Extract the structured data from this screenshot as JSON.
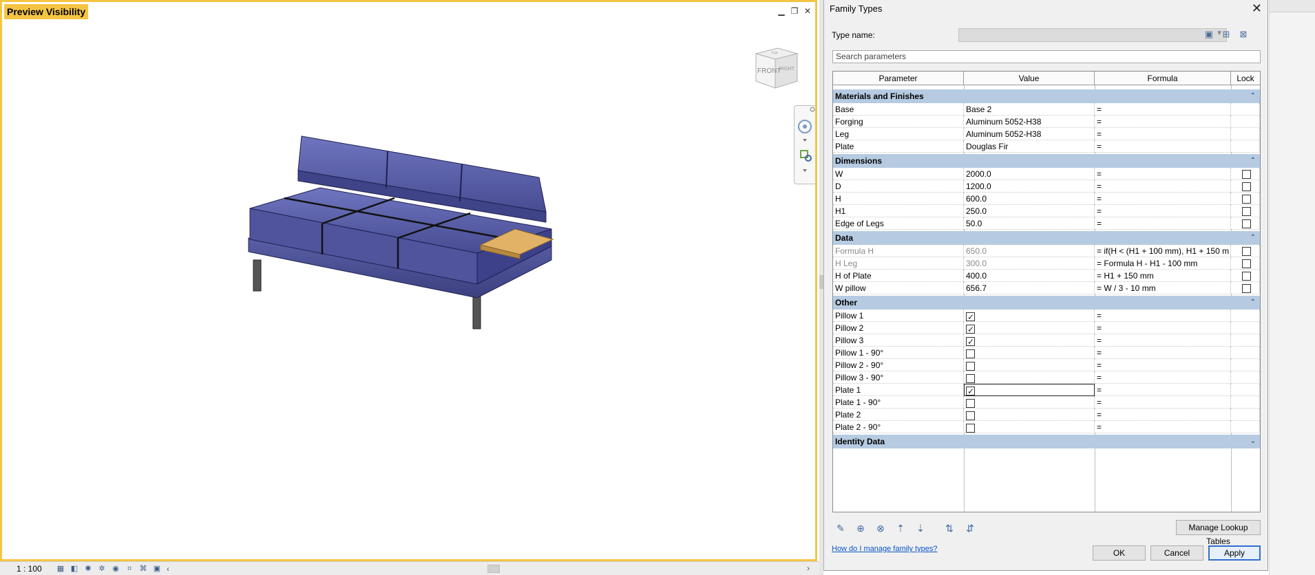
{
  "viewport": {
    "title": "Preview Visibility",
    "viewcube_face": "FRONT",
    "viewcube_side": "RIGHT",
    "viewcube_top": "TOP"
  },
  "statusbar": {
    "scale": "1 : 100"
  },
  "dialog": {
    "title": "Family Types",
    "type_name_label": "Type name:",
    "search_placeholder": "Search parameters",
    "columns": [
      "Parameter",
      "Value",
      "Formula",
      "Lock"
    ],
    "groups": {
      "materials": "Materials and Finishes",
      "dimensions": "Dimensions",
      "data": "Data",
      "other": "Other",
      "identity": "Identity Data"
    },
    "materials_rows": [
      {
        "param": "Base",
        "value": "Base 2",
        "formula": "="
      },
      {
        "param": "Forging",
        "value": "Aluminum 5052-H38",
        "formula": "="
      },
      {
        "param": "Leg",
        "value": "Aluminum 5052-H38",
        "formula": "="
      },
      {
        "param": "Plate",
        "value": "Douglas Fir",
        "formula": "="
      }
    ],
    "dimension_rows": [
      {
        "param": "W",
        "value": "2000.0",
        "formula": "="
      },
      {
        "param": "D",
        "value": "1200.0",
        "formula": "="
      },
      {
        "param": "H",
        "value": "600.0",
        "formula": "="
      },
      {
        "param": "H1",
        "value": "250.0",
        "formula": "="
      },
      {
        "param": "Edge of Legs",
        "value": "50.0",
        "formula": "="
      }
    ],
    "data_rows": [
      {
        "param": "Formula H",
        "value": "650.0",
        "formula": "= if(H < (H1 + 100 mm), H1 + 150 m",
        "greyed": true
      },
      {
        "param": "H Leg",
        "value": "300.0",
        "formula": "= Formula H - H1 - 100 mm",
        "greyed": true
      },
      {
        "param": "H of Plate",
        "value": "400.0",
        "formula": "= H1 + 150 mm",
        "greyed": false
      },
      {
        "param": "W pillow",
        "value": "656.7",
        "formula": "= W / 3 - 10 mm",
        "greyed": false
      }
    ],
    "other_rows": [
      {
        "param": "Pillow 1",
        "checked": true,
        "formula": "="
      },
      {
        "param": "Pillow 2",
        "checked": true,
        "formula": "="
      },
      {
        "param": "Pillow 3",
        "checked": true,
        "formula": "="
      },
      {
        "param": "Pillow 1 - 90°",
        "checked": false,
        "formula": "="
      },
      {
        "param": "Pillow 2 - 90°",
        "checked": false,
        "formula": "="
      },
      {
        "param": "Pillow 3 - 90°",
        "checked": false,
        "formula": "="
      },
      {
        "param": "Plate 1",
        "checked": true,
        "formula": "=",
        "selected": true
      },
      {
        "param": "Plate 1 - 90°",
        "checked": false,
        "formula": "="
      },
      {
        "param": "Plate 2",
        "checked": false,
        "formula": "="
      },
      {
        "param": "Plate 2 - 90°",
        "checked": false,
        "formula": "="
      }
    ],
    "manage_lookup": "Manage Lookup Tables",
    "help_link": "How do I manage family types?",
    "ok": "OK",
    "cancel": "Cancel",
    "apply": "Apply"
  },
  "colors": {
    "viewport_border": "#f5c542",
    "group_header": "#b6cbe2",
    "sofa_fabric": "#5b60a8",
    "plate_wood": "#e2b267",
    "link": "#0b55c8"
  }
}
